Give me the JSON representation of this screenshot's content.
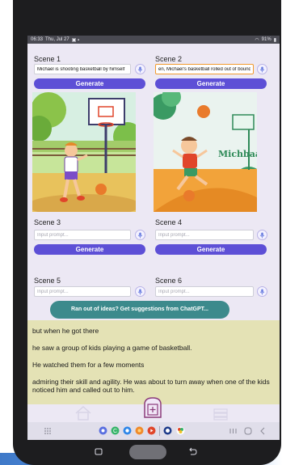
{
  "status_bar": {
    "time": "06:33",
    "date": "Thu, Jul 27",
    "battery": "91%"
  },
  "scenes": [
    {
      "title": "Scene 1",
      "prompt_value": "Michael is shooting basketball by himself",
      "placeholder": "Input prompt...",
      "generate_label": "Generate"
    },
    {
      "title": "Scene 2",
      "prompt_value": "en, Michael's basketball rolled out of bounds",
      "placeholder": "Input prompt...",
      "generate_label": "Generate"
    },
    {
      "title": "Scene 3",
      "prompt_value": "",
      "placeholder": "Input prompt...",
      "generate_label": "Generate"
    },
    {
      "title": "Scene 4",
      "prompt_value": "",
      "placeholder": "Input prompt...",
      "generate_label": "Generate"
    },
    {
      "title": "Scene 5",
      "prompt_value": "",
      "placeholder": "Input prompt..."
    },
    {
      "title": "Scene 6",
      "prompt_value": "",
      "placeholder": "Input prompt..."
    }
  ],
  "scene2_illustration_text": "Michbaal",
  "suggestion_button": "Ran out of ideas? Get suggestions from ChatGPT...",
  "story_lines": [
    "but when he got there",
    "he saw a group of kids playing a game of basketball.",
    "He watched them for a few moments",
    "admiring their skill and agility. He was about to turn away when one of the kids noticed him and called out to him."
  ],
  "colors": {
    "primary_button": "#5d4fd6",
    "suggestion_button": "#3c8a8c",
    "story_background": "#e4e2b5",
    "focus_border": "#f29a2e"
  },
  "icons": {
    "bottom_nav": [
      "home-icon",
      "add-story-icon",
      "library-icon"
    ],
    "taskbar_apps": [
      "app-grid-icon",
      "browser-icon",
      "messenger-icon",
      "chat-icon",
      "photos-icon",
      "youtube-icon",
      "app-icon",
      "color-icon"
    ]
  }
}
